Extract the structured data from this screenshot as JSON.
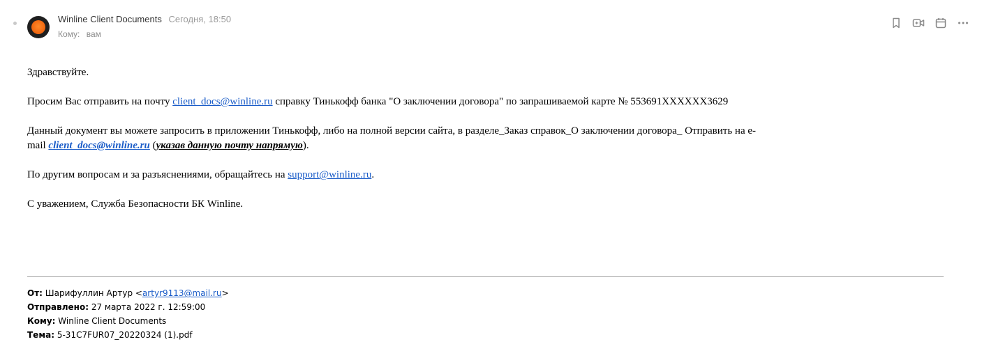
{
  "colors": {
    "link": "#1a5cc8",
    "muted": "#9a9a9a",
    "avatar_accent": "#f26a12"
  },
  "header": {
    "sender_name": "Winline Client Documents",
    "date": "Сегодня, 18:50",
    "to_label": "Кому:",
    "to_value": "вам"
  },
  "toolbar": [
    {
      "icon": "bookmark-icon"
    },
    {
      "icon": "video-call-icon"
    },
    {
      "icon": "calendar-icon"
    },
    {
      "icon": "more-icon"
    }
  ],
  "body": {
    "greeting": "Здравствуйте.",
    "p1_before": "Просим Вас отправить на почту ",
    "p1_link": "client_docs@winline.ru",
    "p1_after": " справку Тинькофф банка \"О заключении договора\" по запрашиваемой карте № 553691XXXXXX3629",
    "p2_line1": "Данный  документ вы можете запросить в приложении Тинькофф, либо на полной версии сайта, в разделе_Заказ справок_О заключении договора_ Отправить на e-",
    "p2_before": "mail ",
    "p2_link": "client_docs@winline.ru",
    "p2_open": " (",
    "p2_em": "указав данную почту напрямую",
    "p2_close": ").",
    "p3_before": "По другим вопросам и за разъяснениями, обращайтесь на ",
    "p3_link": "support@winline.ru",
    "p3_after": ".",
    "signature": "С уважением, Служба Безопасности БК Winline."
  },
  "forwarded": {
    "from_label": "От:",
    "from_name": " Шарифуллин Артур <",
    "from_email": "artyr9113@mail.ru",
    "from_close": ">",
    "sent_label": "Отправлено:",
    "sent_value": " 27 марта 2022 г. 12:59:00",
    "to_label": "Кому:",
    "to_value": " Winline Client Documents",
    "subject_label": "Тема:",
    "subject_value": " 5-31C7FUR07_20220324 (1).pdf"
  }
}
